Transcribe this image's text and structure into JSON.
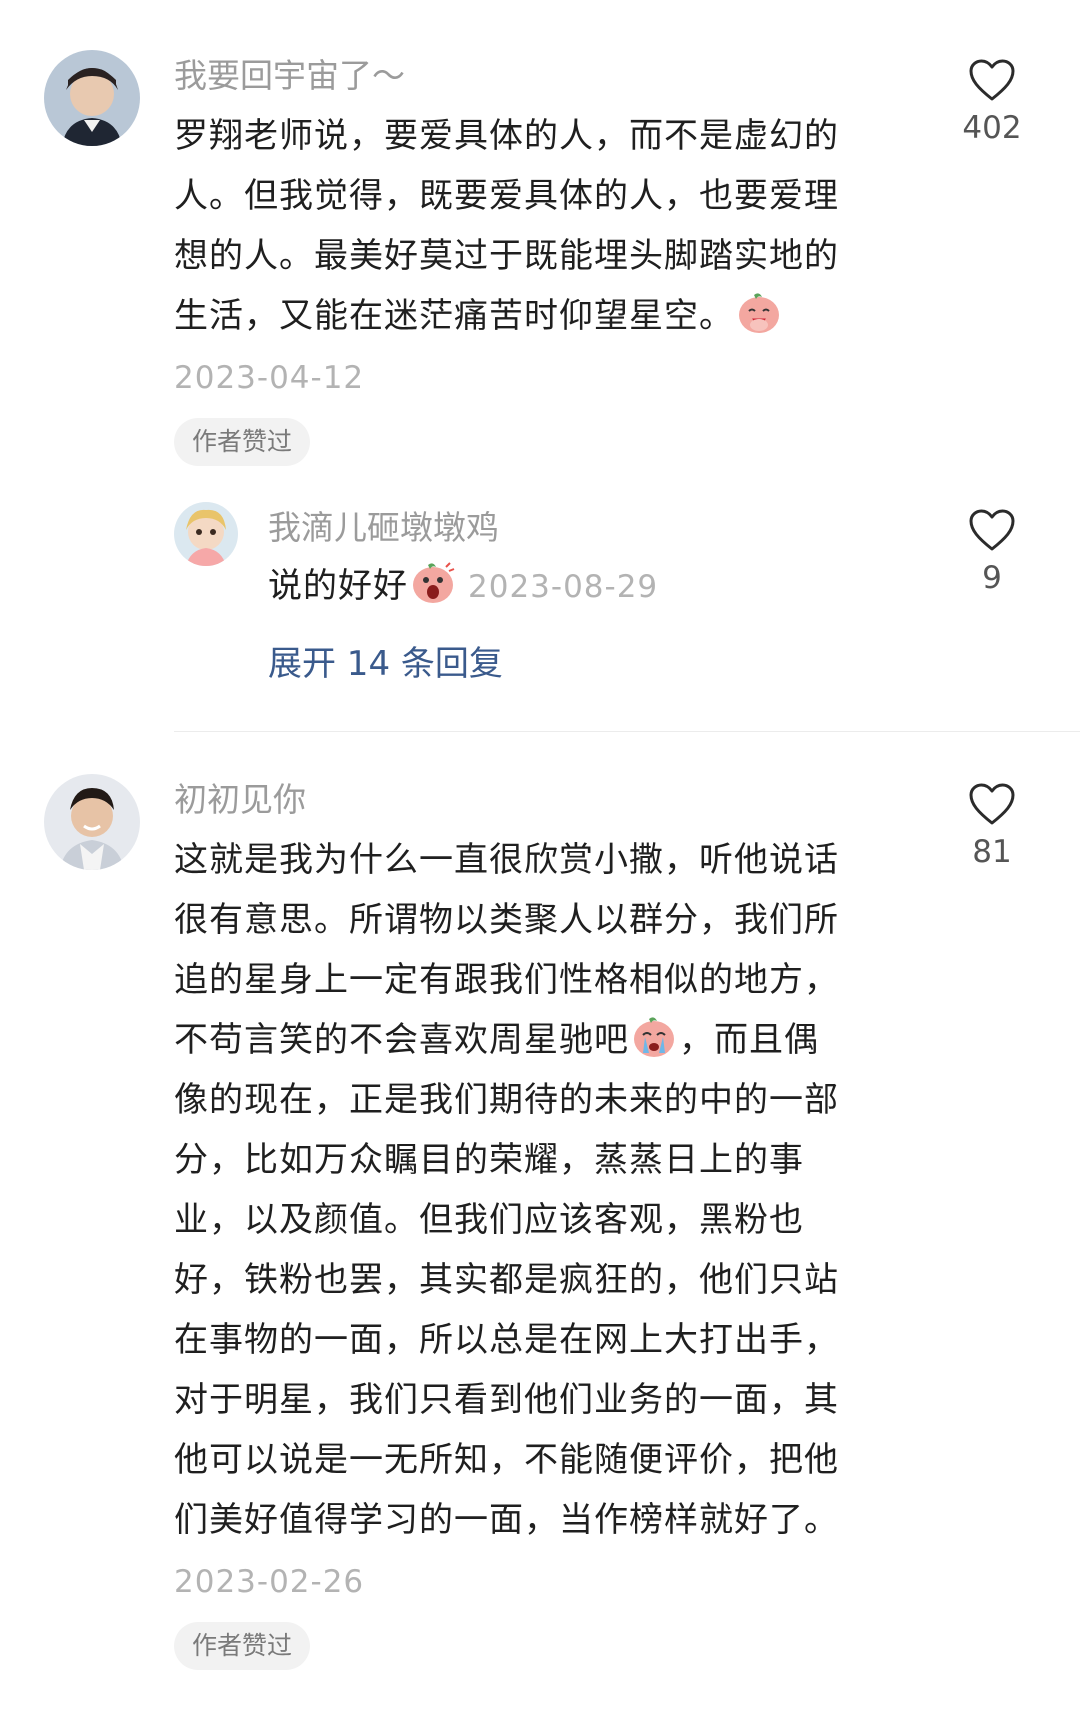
{
  "comments": [
    {
      "username": "我要回宇宙了～",
      "lines": [
        "罗翔老师说，要爱具体的人，而不是虚幻的",
        "人。但我觉得，既要爱具体的人，也要爱理",
        "想的人。最美好莫过于既能埋头脚踏实地的",
        "生活，又能在迷茫痛苦时仰望星空。"
      ],
      "emoji": "praying-emoji",
      "date": "2023-04-12",
      "tag": "作者赞过",
      "likes": "402",
      "reply": {
        "username": "我滴儿砸墩墩鸡",
        "text": "说的好好",
        "emoji": "shocked-emoji",
        "date": "2023-08-29",
        "likes": "9"
      },
      "expand_label": "展开 14 条回复"
    },
    {
      "username": "初初见你",
      "lines": [
        "这就是我为什么一直很欣赏小撒，听他说话",
        "很有意思。所谓物以类聚人以群分，我们所",
        "追的星身上一定有跟我们性格相似的地方，",
        "不苟言笑的不会喜欢周星驰吧",
        "像的现在，正是我们期待的未来的中的一部",
        "分，比如万众瞩目的荣耀，蒸蒸日上的事",
        "业，以及颜值。但我们应该客观，黑粉也",
        "好，铁粉也罢，其实都是疯狂的，他们只站",
        "在事物的一面，所以总是在网上大打出手，",
        "对于明星，我们只看到他们业务的一面，其",
        "他可以说是一无所知，不能随便评价，把他",
        "们美好值得学习的一面，当作榜样就好了。"
      ],
      "line4_suffix": "，而且偶",
      "emoji": "crying-emoji",
      "date": "2023-02-26",
      "tag": "作者赞过",
      "likes": "81"
    }
  ],
  "colors": {
    "username": "#9b9b9b",
    "date": "#b3b3b3",
    "link": "#3a5a8c",
    "tag_bg": "#f2f2f2"
  }
}
